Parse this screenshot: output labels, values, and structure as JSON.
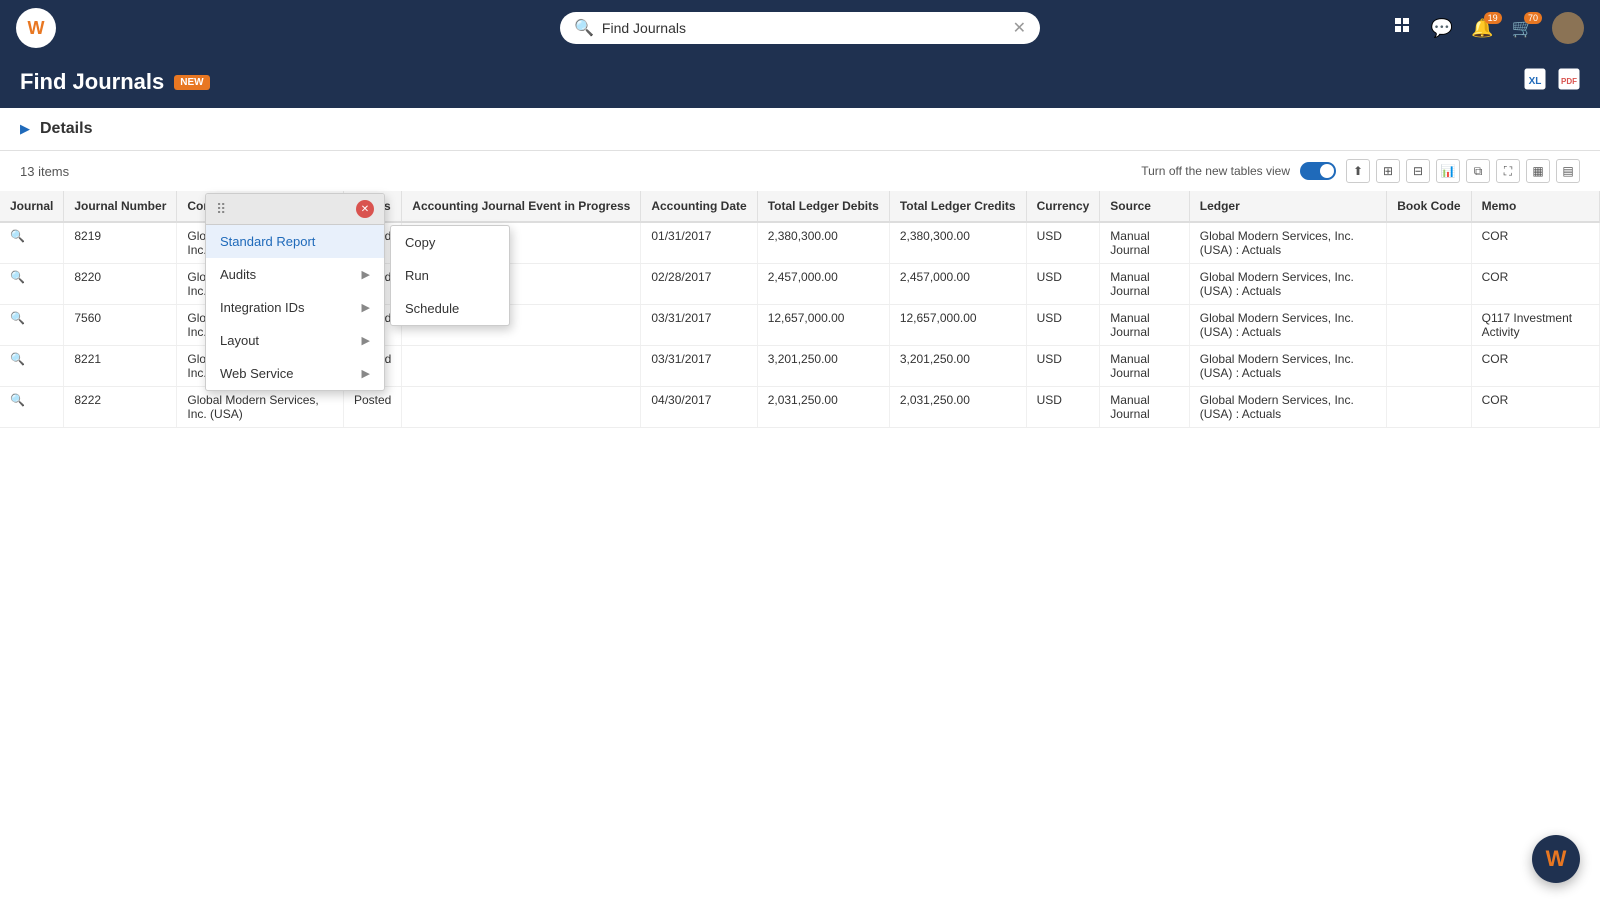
{
  "app": {
    "logo": "W",
    "title": "Find Journals"
  },
  "topnav": {
    "search_placeholder": "Find Journals",
    "search_value": "Find Journals",
    "badges": {
      "notification": "19",
      "cart": "70"
    }
  },
  "page": {
    "title": "Find Journals",
    "new_badge": "NEW",
    "items_count": "13 items",
    "toggle_label": "Turn off the new tables view"
  },
  "details": {
    "label": "Details"
  },
  "context_menu": {
    "standard_report_label": "Standard Report",
    "items": [
      {
        "label": "Standard Report",
        "has_sub": false,
        "active": true
      },
      {
        "label": "Audits",
        "has_sub": true
      },
      {
        "label": "Integration IDs",
        "has_sub": true
      },
      {
        "label": "Layout",
        "has_sub": true
      },
      {
        "label": "Web Service",
        "has_sub": true
      }
    ],
    "sub_items": [
      {
        "label": "Copy"
      },
      {
        "label": "Run"
      },
      {
        "label": "Schedule"
      }
    ]
  },
  "table": {
    "columns": [
      "Journal",
      "Journal Number",
      "Company",
      "Status",
      "Accounting Journal Event in Progress",
      "Accounting Date",
      "Total Ledger Debits",
      "Total Ledger Credits",
      "Currency",
      "Source",
      "Ledger",
      "Book Code",
      "Memo"
    ],
    "rows": [
      {
        "journal": "",
        "journal_number": "8219",
        "company": "Global Modern Services, Inc. (USA)",
        "status": "Posted",
        "event": "",
        "date": "01/31/2017",
        "debits": "2,380,300.00",
        "credits": "2,380,300.00",
        "currency": "USD",
        "source": "Manual Journal",
        "ledger": "Global Modern Services, Inc. (USA) : Actuals",
        "book_code": "",
        "memo": "COR"
      },
      {
        "journal": "",
        "journal_number": "8220",
        "company": "Global Modern Services, Inc. (USA)",
        "status": "Posted",
        "event": "",
        "date": "02/28/2017",
        "debits": "2,457,000.00",
        "credits": "2,457,000.00",
        "currency": "USD",
        "source": "Manual Journal",
        "ledger": "Global Modern Services, Inc. (USA) : Actuals",
        "book_code": "",
        "memo": "COR"
      },
      {
        "journal": "",
        "journal_number": "7560",
        "company": "Global Modern Services, Inc. (USA)",
        "status": "Posted",
        "event": "",
        "date": "03/31/2017",
        "debits": "12,657,000.00",
        "credits": "12,657,000.00",
        "currency": "USD",
        "source": "Manual Journal",
        "ledger": "Global Modern Services, Inc. (USA) : Actuals",
        "book_code": "",
        "memo": "Q117 Investment Activity"
      },
      {
        "journal": "",
        "journal_number": "8221",
        "company": "Global Modern Services, Inc. (USA)",
        "status": "Posted",
        "event": "",
        "date": "03/31/2017",
        "debits": "3,201,250.00",
        "credits": "3,201,250.00",
        "currency": "USD",
        "source": "Manual Journal",
        "ledger": "Global Modern Services, Inc. (USA) : Actuals",
        "book_code": "",
        "memo": "COR"
      },
      {
        "journal": "",
        "journal_number": "8222",
        "company": "Global Modern Services, Inc. (USA)",
        "status": "Posted",
        "event": "",
        "date": "04/30/2017",
        "debits": "2,031,250.00",
        "credits": "2,031,250.00",
        "currency": "USD",
        "source": "Manual Journal",
        "ledger": "Global Modern Services, Inc. (USA) : Actuals",
        "book_code": "",
        "memo": "COR"
      }
    ]
  },
  "assistant": {
    "label": "W"
  }
}
